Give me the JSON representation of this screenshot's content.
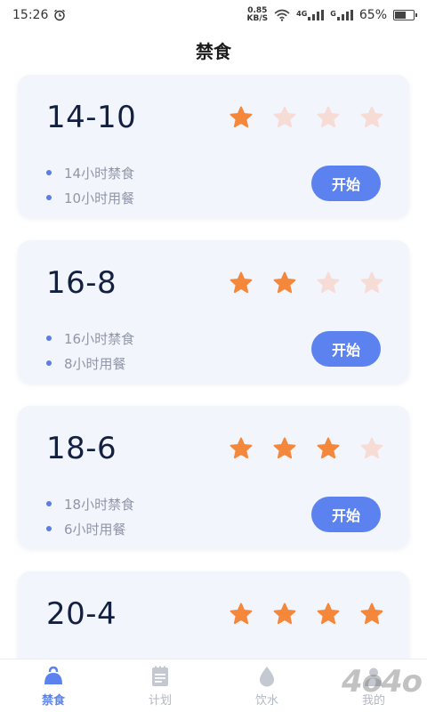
{
  "status_bar": {
    "time": "15:26",
    "net_speed_value": "0.85",
    "net_speed_unit": "KB/S",
    "sim1_label": "4G",
    "sim2_label": "G",
    "battery": "65%",
    "battery_level": 0.65
  },
  "header": {
    "title": "禁食"
  },
  "plans": [
    {
      "name": "14-10",
      "rating": 1,
      "max_rating": 4,
      "fasting": "14小时禁食",
      "eating": "10小时用餐",
      "button": "开始"
    },
    {
      "name": "16-8",
      "rating": 2,
      "max_rating": 4,
      "fasting": "16小时禁食",
      "eating": "8小时用餐",
      "button": "开始"
    },
    {
      "name": "18-6",
      "rating": 3,
      "max_rating": 4,
      "fasting": "18小时禁食",
      "eating": "6小时用餐",
      "button": "开始"
    },
    {
      "name": "20-4",
      "rating": 4,
      "max_rating": 4,
      "fasting": "",
      "eating": "",
      "button": ""
    }
  ],
  "tabs": [
    {
      "label": "禁食",
      "icon": "kettlebell-icon",
      "active": true
    },
    {
      "label": "计划",
      "icon": "notepad-icon",
      "active": false
    },
    {
      "label": "饮水",
      "icon": "water-drop-icon",
      "active": false
    },
    {
      "label": "我的",
      "icon": "profile-icon",
      "active": false
    }
  ],
  "watermark": "4o4o",
  "colors": {
    "accent": "#5b82ee",
    "star_filled": "#f5873a",
    "star_empty": "#f7dcd6",
    "card_bg": "#f3f5fd",
    "muted_text": "#8f96a6"
  }
}
